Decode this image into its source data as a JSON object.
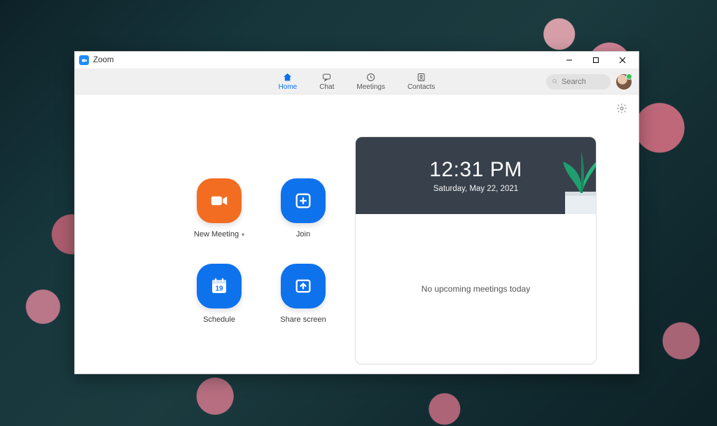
{
  "window": {
    "title": "Zoom"
  },
  "tabs": [
    {
      "label": "Home",
      "active": true
    },
    {
      "label": "Chat",
      "active": false
    },
    {
      "label": "Meetings",
      "active": false
    },
    {
      "label": "Contacts",
      "active": false
    }
  ],
  "search": {
    "placeholder": "Search"
  },
  "actions": {
    "new_meeting": "New Meeting",
    "join": "Join",
    "schedule": "Schedule",
    "schedule_day": "19",
    "share_screen": "Share screen"
  },
  "panel": {
    "time": "12:31 PM",
    "date": "Saturday, May 22, 2021",
    "empty_text": "No upcoming meetings today"
  },
  "colors": {
    "accent": "#0e72ed",
    "orange": "#f26d21"
  }
}
